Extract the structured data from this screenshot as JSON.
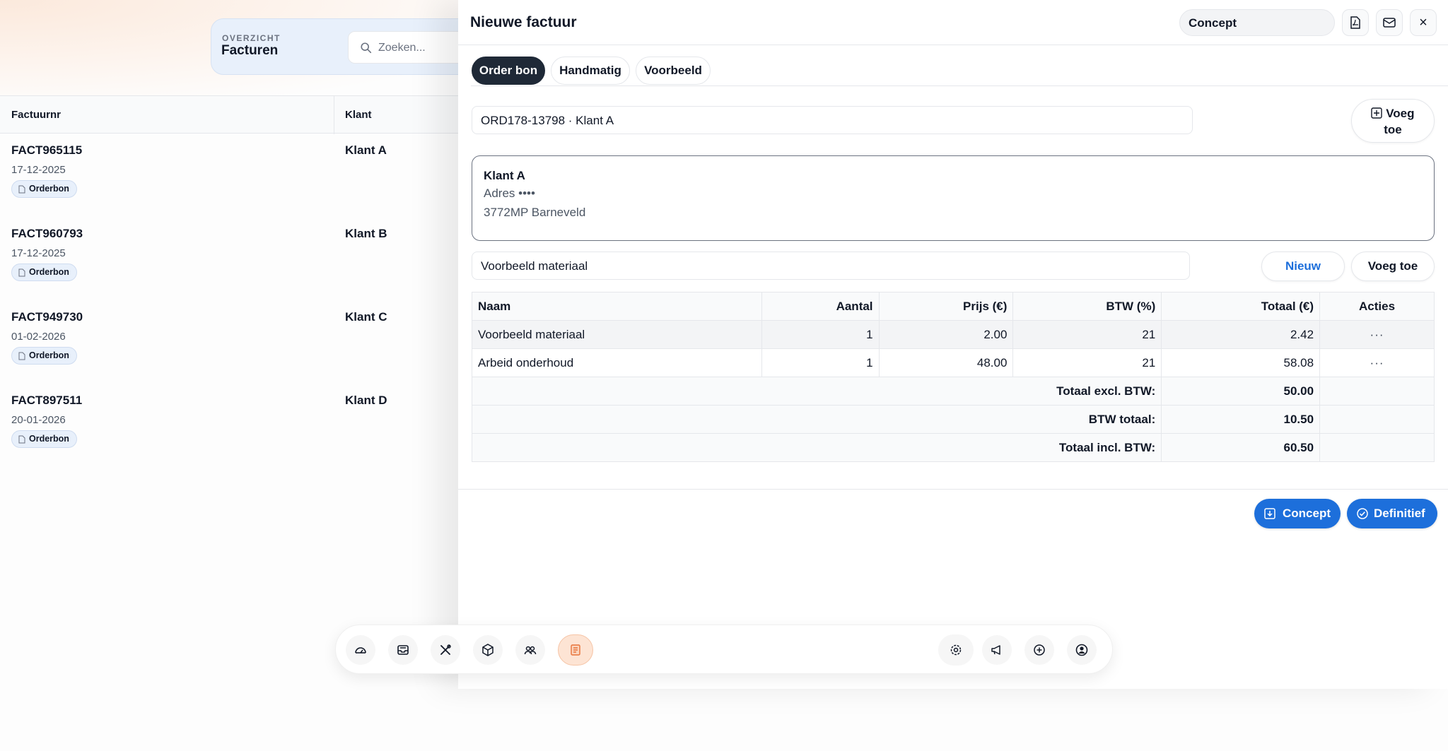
{
  "background": {
    "overview_label": "OVERZICHT",
    "overview_title": "Facturen",
    "search_placeholder": "Zoeken...",
    "columns": [
      "Factuurnr",
      "Klant"
    ],
    "invoices": [
      {
        "number": "FACT965115",
        "date": "17-12-2025",
        "badge": "Orderbon",
        "client": "Klant A"
      },
      {
        "number": "FACT960793",
        "date": "17-12-2025",
        "badge": "Orderbon",
        "client": "Klant B"
      },
      {
        "number": "FACT949730",
        "date": "01-02-2026",
        "badge": "Orderbon",
        "client": "Klant C"
      },
      {
        "number": "FACT897511",
        "date": "20-01-2026",
        "badge": "Orderbon",
        "client": "Klant D"
      }
    ]
  },
  "panel": {
    "title": "Nieuwe factuur",
    "status": "Concept",
    "header_icons": [
      "pdf-icon",
      "mail-icon",
      "close-icon"
    ],
    "close_glyph": "×",
    "tabs": [
      {
        "label": "Order bon",
        "active": true
      },
      {
        "label": "Handmatig",
        "active": false
      },
      {
        "label": "Voorbeeld",
        "active": false
      }
    ],
    "order_field": "ORD178-13798 · Klant A",
    "add_order_button_line1": "Voeg",
    "add_order_button_line2": "toe",
    "client": {
      "name": "Klant A",
      "address": "Adres ••••",
      "city": "3772MP Barneveld"
    },
    "material_field": "Voorbeeld materiaal",
    "new_button": "Nieuw",
    "add_button": "Voeg toe",
    "table": {
      "headers": [
        "Naam",
        "Aantal",
        "Prijs (€)",
        "BTW (%)",
        "Totaal (€)",
        "Acties"
      ],
      "rows": [
        {
          "name": "Voorbeeld materiaal",
          "qty": "1",
          "price": "2.00",
          "vat": "21",
          "total": "2.42",
          "action": "···"
        },
        {
          "name": "Arbeid onderhoud",
          "qty": "1",
          "price": "48.00",
          "vat": "21",
          "total": "58.08",
          "action": "···"
        }
      ],
      "summary": [
        {
          "label": "Totaal excl. BTW:",
          "value": "50.00"
        },
        {
          "label": "BTW totaal:",
          "value": "10.50"
        },
        {
          "label": "Totaal incl. BTW:",
          "value": "60.50"
        }
      ]
    },
    "concept_button": "Concept",
    "final_button": "Definitief"
  },
  "dock": {
    "items": [
      "dashboard-icon",
      "inbox-icon",
      "tools-icon",
      "box-icon",
      "users-icon",
      "invoice-icon",
      "settings-icon",
      "megaphone-icon",
      "plus-circle-icon",
      "account-icon"
    ],
    "active": "invoice-icon"
  },
  "colors": {
    "primary": "#1d6fdb",
    "dark_tab": "#1f2937",
    "active_dock": "#fde4d4",
    "overview_bg": "#e8f0fb"
  }
}
